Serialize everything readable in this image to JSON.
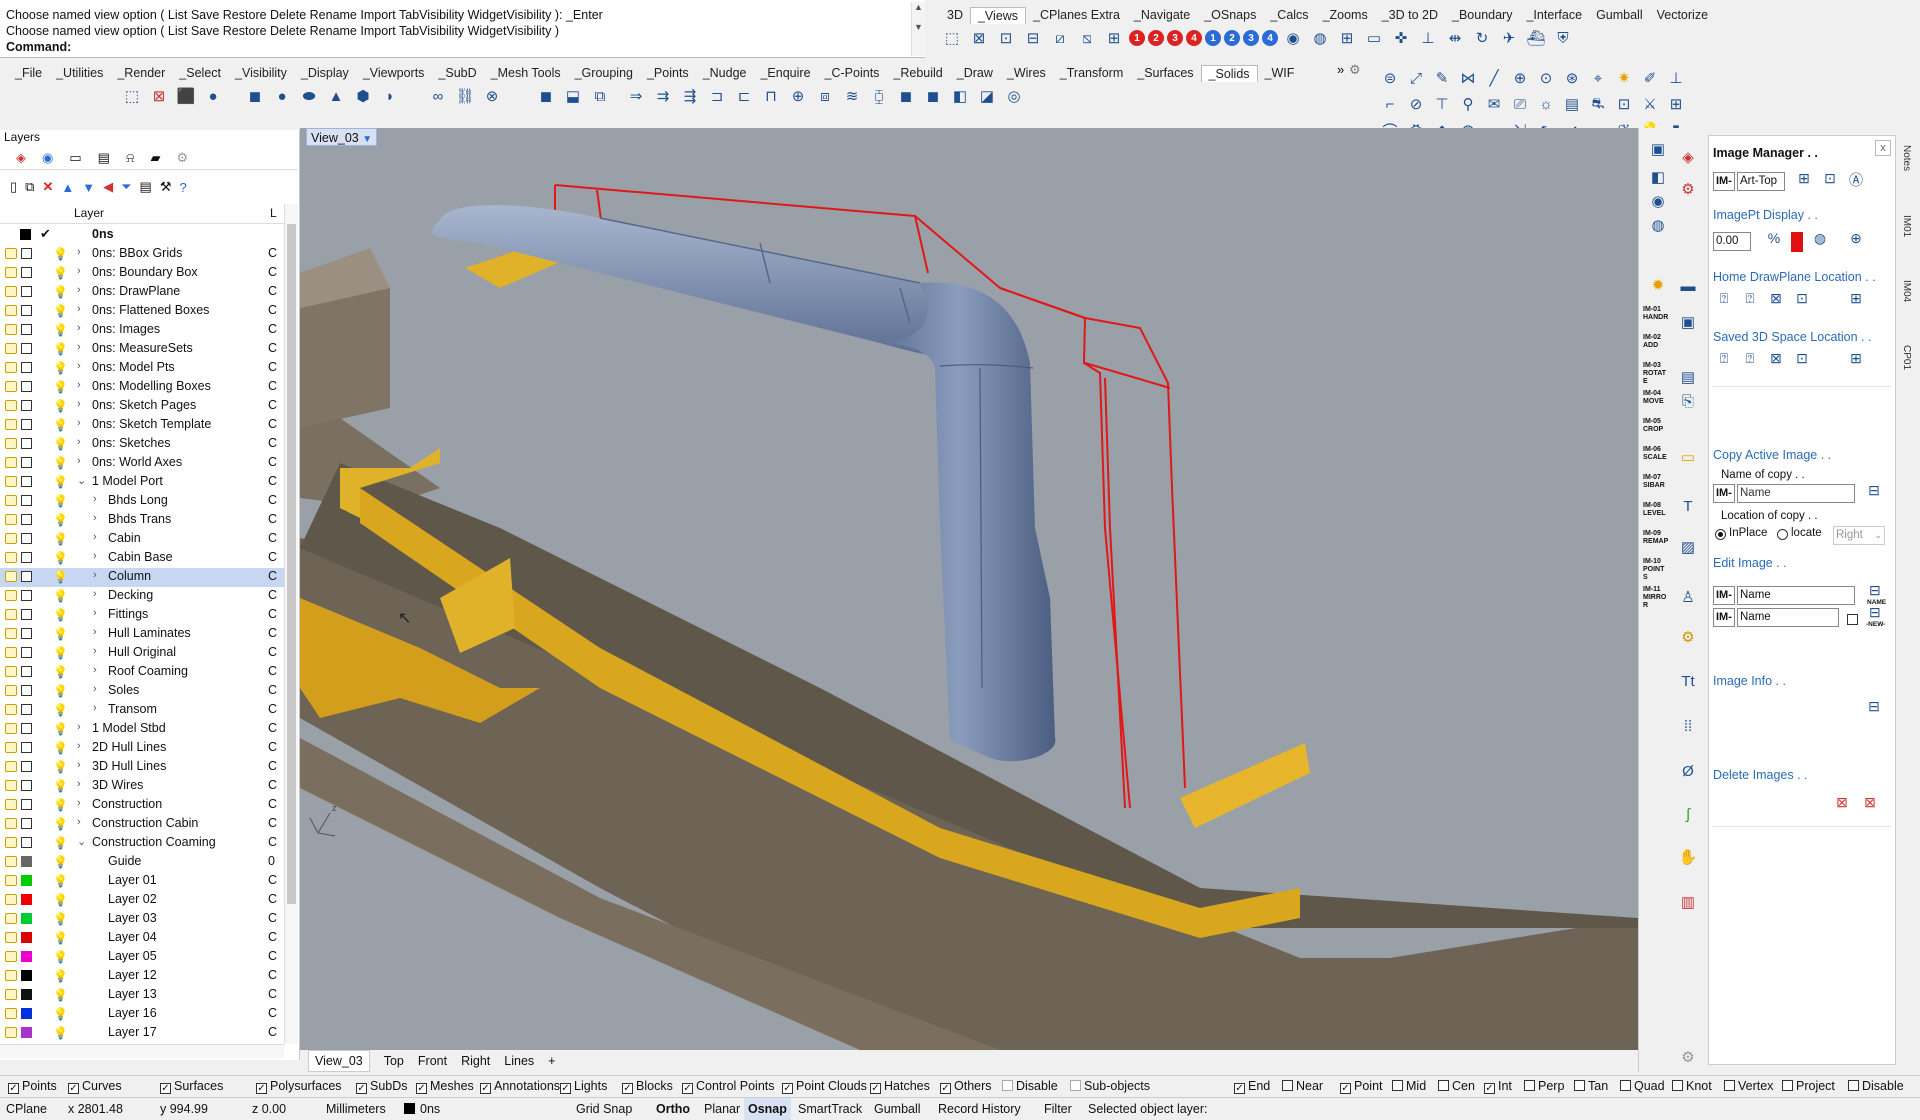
{
  "command": {
    "line1": "Choose named view option ( List  Save  Restore  Delete  Rename  Import  TabVisibility  WidgetVisibility ): _Enter",
    "line2": "Choose named view option ( List  Save  Restore  Delete  Rename  Import  TabVisibility  WidgetVisibility )",
    "prompt": "Command:"
  },
  "right_tabs": [
    "3D",
    "_Views",
    "_CPlanes Extra",
    "_Navigate",
    "_OSnaps",
    "_Calcs",
    "_Zooms",
    "_3D to 2D",
    "_Boundary",
    "_Interface",
    "Gumball",
    "Vectorize"
  ],
  "left_tabs": [
    "_File",
    "_Utilities",
    "_Render",
    "_Select",
    "_Visibility",
    "_Display",
    "_Viewports",
    "_SubD",
    "_Mesh Tools",
    "_Grouping",
    "_Points",
    "_Nudge",
    "_Enquire",
    "_C-Points",
    "_Rebuild",
    "_Draw",
    "_Wires",
    "_Transform",
    "_Surfaces",
    "_Solids",
    "_WIF"
  ],
  "numbered_buttons": [
    "1",
    "2",
    "3",
    "4",
    "1",
    "2",
    "3",
    "4"
  ],
  "layers": {
    "title": "Layers",
    "col_layer": "Layer",
    "col_l": "L",
    "root": "0ns",
    "rows": [
      {
        "name": "0ns: BBox Grids",
        "indent": 1,
        "exp": "›",
        "c": "C"
      },
      {
        "name": "0ns: Boundary Box",
        "indent": 1,
        "exp": "›",
        "c": "C"
      },
      {
        "name": "0ns: DrawPlane",
        "indent": 1,
        "exp": "›",
        "c": "C"
      },
      {
        "name": "0ns: Flattened Boxes",
        "indent": 1,
        "exp": "›",
        "c": "C"
      },
      {
        "name": "0ns: Images",
        "indent": 1,
        "exp": "›",
        "c": "C"
      },
      {
        "name": "0ns: MeasureSets",
        "indent": 1,
        "exp": "›",
        "c": "C"
      },
      {
        "name": "0ns: Model Pts",
        "indent": 1,
        "exp": "›",
        "c": "C"
      },
      {
        "name": "0ns: Modelling Boxes",
        "indent": 1,
        "exp": "›",
        "c": "C"
      },
      {
        "name": "0ns: Sketch Pages",
        "indent": 1,
        "exp": "›",
        "c": "C"
      },
      {
        "name": "0ns: Sketch Template",
        "indent": 1,
        "exp": "›",
        "c": "C"
      },
      {
        "name": "0ns: Sketches",
        "indent": 1,
        "exp": "›",
        "c": "C"
      },
      {
        "name": "0ns: World Axes",
        "indent": 1,
        "exp": "›",
        "c": "C"
      },
      {
        "name": "1 Model Port",
        "indent": 1,
        "exp": "⌄",
        "c": "C"
      },
      {
        "name": "Bhds Long",
        "indent": 2,
        "exp": "›",
        "c": "C"
      },
      {
        "name": "Bhds Trans",
        "indent": 2,
        "exp": "›",
        "c": "C"
      },
      {
        "name": "Cabin",
        "indent": 2,
        "exp": "›",
        "c": "C"
      },
      {
        "name": "Cabin Base",
        "indent": 2,
        "exp": "›",
        "c": "C"
      },
      {
        "name": "Column",
        "indent": 2,
        "exp": "›",
        "c": "C",
        "selected": true
      },
      {
        "name": "Decking",
        "indent": 2,
        "exp": "›",
        "c": "C"
      },
      {
        "name": "Fittings",
        "indent": 2,
        "exp": "›",
        "c": "C"
      },
      {
        "name": "Hull Laminates",
        "indent": 2,
        "exp": "›",
        "c": "C"
      },
      {
        "name": "Hull Original",
        "indent": 2,
        "exp": "›",
        "c": "C"
      },
      {
        "name": "Roof Coaming",
        "indent": 2,
        "exp": "›",
        "c": "C"
      },
      {
        "name": "Soles",
        "indent": 2,
        "exp": "›",
        "c": "C"
      },
      {
        "name": "Transom",
        "indent": 2,
        "exp": "›",
        "c": "C"
      },
      {
        "name": "1 Model Stbd",
        "indent": 1,
        "exp": "›",
        "c": "C"
      },
      {
        "name": "2D Hull Lines",
        "indent": 1,
        "exp": "›",
        "c": "C"
      },
      {
        "name": "3D Hull Lines",
        "indent": 1,
        "exp": "›",
        "c": "C"
      },
      {
        "name": "3D Wires",
        "indent": 1,
        "exp": "›",
        "c": "C"
      },
      {
        "name": "Construction",
        "indent": 1,
        "exp": "›",
        "c": "C"
      },
      {
        "name": "Construction Cabin",
        "indent": 1,
        "exp": "›",
        "c": "C"
      },
      {
        "name": "Construction Coaming",
        "indent": 1,
        "exp": "⌄",
        "c": "C"
      },
      {
        "name": "Guide",
        "indent": 2,
        "exp": "",
        "c": "0",
        "color": "#666666"
      },
      {
        "name": "Layer 01",
        "indent": 2,
        "exp": "",
        "c": "C",
        "color": "#00cc00"
      },
      {
        "name": "Layer 02",
        "indent": 2,
        "exp": "",
        "c": "C",
        "color": "#ee0000"
      },
      {
        "name": "Layer 03",
        "indent": 2,
        "exp": "",
        "c": "C",
        "color": "#00cc33"
      },
      {
        "name": "Layer 04",
        "indent": 2,
        "exp": "",
        "c": "C",
        "color": "#dd0000"
      },
      {
        "name": "Layer 05",
        "indent": 2,
        "exp": "",
        "c": "C",
        "color": "#ee00cc"
      },
      {
        "name": "Layer 12",
        "indent": 2,
        "exp": "",
        "c": "C",
        "color": "#000000"
      },
      {
        "name": "Layer 13",
        "indent": 2,
        "exp": "",
        "c": "C",
        "color": "#111111"
      },
      {
        "name": "Layer 16",
        "indent": 2,
        "exp": "",
        "c": "C",
        "color": "#0033dd"
      },
      {
        "name": "Layer 17",
        "indent": 2,
        "exp": "",
        "c": "C",
        "color": "#aa33cc"
      }
    ]
  },
  "viewport": {
    "label": "View_03",
    "tabs": [
      "View_03",
      "Top",
      "Front",
      "Right",
      "Lines"
    ],
    "add_tab": "+"
  },
  "im_strip": [
    "IM-01 HANDR",
    "IM-02 ADD",
    "IM-03 ROTATE",
    "IM-04 MOVE",
    "IM-05 CROP",
    "IM-06 SCALE",
    "IM-07 SIBAR",
    "IM-08 LEVEL",
    "IM-09 REMAP",
    "IM-10 POINTS",
    "IM-11 MIRROR"
  ],
  "image_manager": {
    "title": "Image Manager . .",
    "close": "x",
    "prefix": "IM-",
    "art_value": "Art-Top",
    "imagept_header": "ImagePt Display . .",
    "imagept_value": "0.00",
    "home_header": "Home DrawPlane Location . .",
    "saved_header": "Saved 3D Space Location . .",
    "copy_header": "Copy Active Image . .",
    "name_of_copy": "Name of copy . .",
    "name_placeholder": "Name",
    "location_label": "Location of copy . .",
    "inplace_label": "InPlace",
    "locate_label": "locate",
    "direction_value": "Right",
    "edit_header": "Edit Image . .",
    "name_btn": "NAME",
    "new_btn": "-NEW-",
    "info_header": "Image Info . .",
    "delete_header": "Delete Images . ."
  },
  "side_tabs": [
    "Notes",
    "IM01",
    "IM04",
    "CP01"
  ],
  "filter": {
    "left": [
      {
        "label": "Points",
        "checked": true
      },
      {
        "label": "Curves",
        "checked": true
      },
      {
        "label": "Surfaces",
        "checked": true
      },
      {
        "label": "Polysurfaces",
        "checked": true
      },
      {
        "label": "SubDs",
        "checked": true
      },
      {
        "label": "Meshes",
        "checked": true
      },
      {
        "label": "Annotations",
        "checked": true
      },
      {
        "label": "Lights",
        "checked": true
      },
      {
        "label": "Blocks",
        "checked": true
      },
      {
        "label": "Control Points",
        "checked": true
      },
      {
        "label": "Point Clouds",
        "checked": true
      },
      {
        "label": "Hatches",
        "checked": true
      },
      {
        "label": "Others",
        "checked": true
      },
      {
        "label": "Disable",
        "checked": false
      },
      {
        "label": "Sub-objects",
        "checked": false
      }
    ],
    "right": [
      {
        "label": "End",
        "checked": true
      },
      {
        "label": "Near",
        "checked": false
      },
      {
        "label": "Point",
        "checked": true
      },
      {
        "label": "Mid",
        "checked": false
      },
      {
        "label": "Cen",
        "checked": false
      },
      {
        "label": "Int",
        "checked": true
      },
      {
        "label": "Perp",
        "checked": false
      },
      {
        "label": "Tan",
        "checked": false
      },
      {
        "label": "Quad",
        "checked": false
      },
      {
        "label": "Knot",
        "checked": false
      },
      {
        "label": "Vertex",
        "checked": false
      },
      {
        "label": "Project",
        "checked": false
      },
      {
        "label": "Disable",
        "checked": false
      }
    ]
  },
  "status": {
    "cplane": "CPlane",
    "x": "x 2801.48",
    "y": "y 994.99",
    "z": "z 0.00",
    "units": "Millimeters",
    "layer": "0ns",
    "grid_snap": "Grid Snap",
    "ortho": "Ortho",
    "planar": "Planar",
    "osnap": "Osnap",
    "smarttrack": "SmartTrack",
    "gumball": "Gumball",
    "record": "Record History",
    "filter": "Filter",
    "message": "Selected object layer:"
  }
}
